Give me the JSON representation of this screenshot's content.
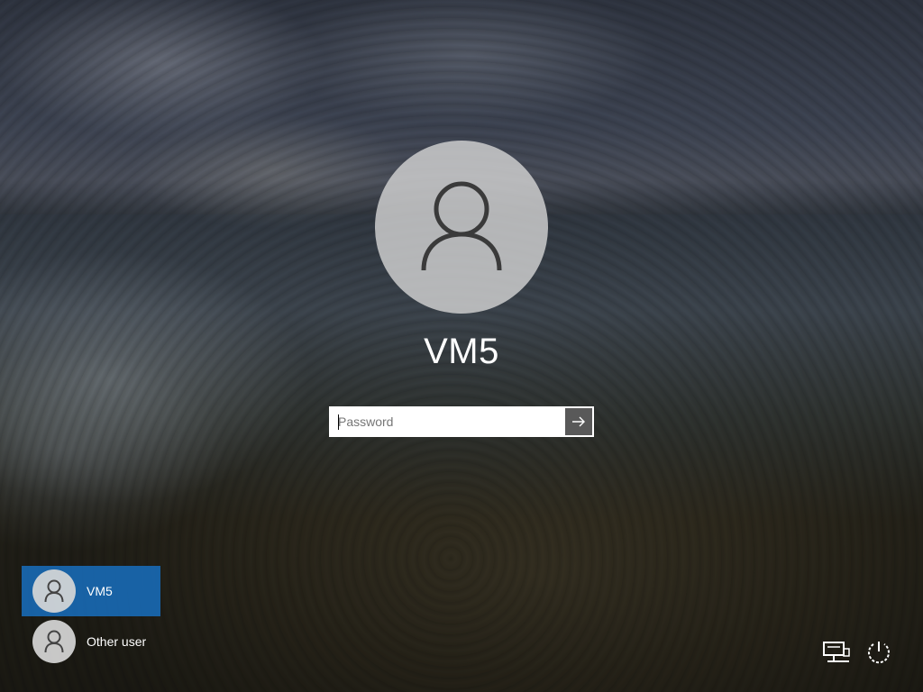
{
  "login": {
    "username": "VM5",
    "password_placeholder": "Password",
    "submit_icon": "arrow-right-icon"
  },
  "user_list": [
    {
      "name": "VM5",
      "selected": true,
      "icon": "user-icon"
    },
    {
      "name": "Other user",
      "selected": false,
      "icon": "user-icon"
    }
  ],
  "system_icons": {
    "network": "network-icon",
    "power": "power-icon"
  },
  "colors": {
    "selected_user_bg": "#176ebe",
    "avatar_bg": "#d2d2d2",
    "text": "#ffffff"
  }
}
